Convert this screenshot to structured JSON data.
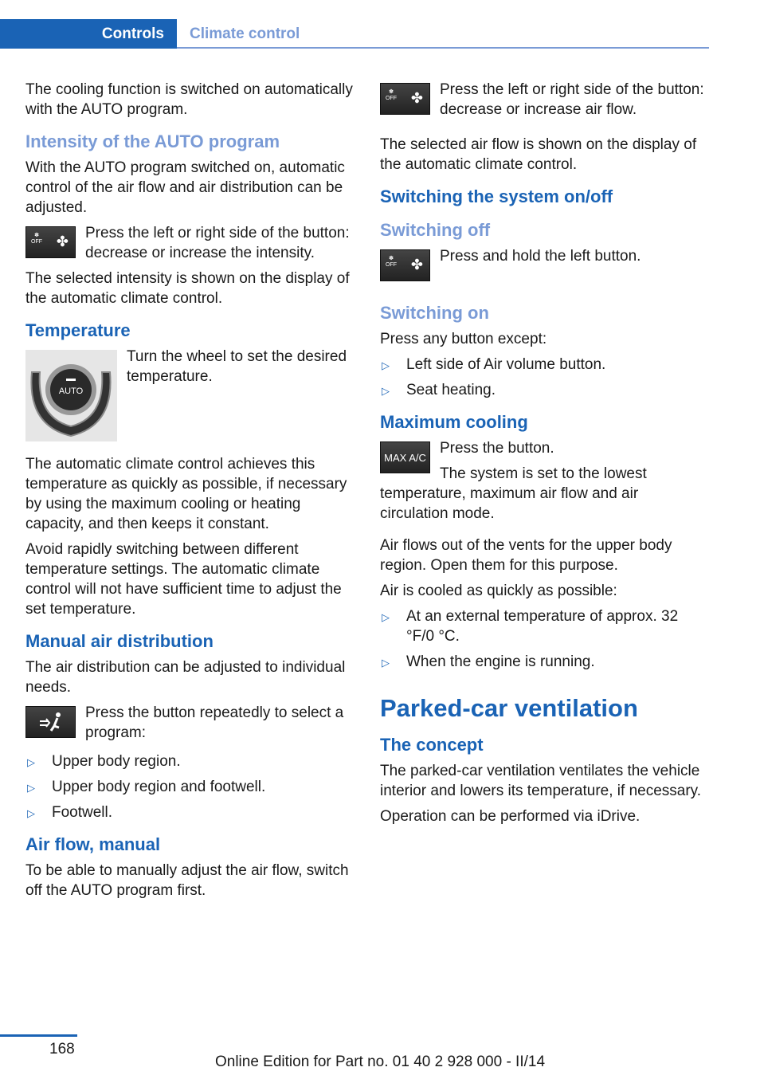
{
  "header": {
    "section": "Controls",
    "chapter": "Climate control"
  },
  "left": {
    "intro": "The cooling function is switched on automatically with the AUTO program.",
    "intensity": {
      "heading": "Intensity of the AUTO program",
      "p1": "With the AUTO program switched on, automatic control of the air flow and air distribution can be adjusted.",
      "p2": "Press the left or right side of the button: decrease or increase the intensity.",
      "p3": "The selected intensity is shown on the display of the automatic climate control."
    },
    "temperature": {
      "heading": "Temperature",
      "p1": "Turn the wheel to set the desired temperature.",
      "p2": "The automatic climate control achieves this temperature as quickly as possible, if necessary by using the maximum cooling or heating capacity, and then keeps it constant.",
      "p3": "Avoid rapidly switching between different temperature settings. The automatic climate control will not have sufficient time to adjust the set temperature."
    },
    "distribution": {
      "heading": "Manual air distribution",
      "p1": "The air distribution can be adjusted to individual needs.",
      "p2": "Press the button repeatedly to select a program:",
      "items": [
        "Upper body region.",
        "Upper body region and footwell.",
        "Footwell."
      ]
    },
    "airflow": {
      "heading": "Air flow, manual",
      "p1": "To be able to manually adjust the air flow, switch off the AUTO program first."
    }
  },
  "right": {
    "airflow_p2": "Press the left or right side of the button: decrease or increase air flow.",
    "airflow_p3": "The selected air flow is shown on the display of the automatic climate control.",
    "system_heading": "Switching the system on/off",
    "off_heading": "Switching off",
    "off_p": "Press and hold the left button.",
    "on_heading": "Switching on",
    "on_p": "Press any button except:",
    "on_items": [
      "Left side of Air volume button.",
      "Seat heating."
    ],
    "maxcool": {
      "heading": "Maximum cooling",
      "p1": "Press the button.",
      "p2": "The system is set to the lowest temperature, maximum air flow and air circulation mode.",
      "p3": "Air flows out of the vents for the upper body region. Open them for this purpose.",
      "p4": "Air is cooled as quickly as possible:",
      "items": [
        "At an external temperature of approx. 32 °F/0 °C.",
        "When the engine is running."
      ]
    },
    "parked": {
      "heading": "Parked-car ventilation",
      "concept_heading": "The concept",
      "p1": "The parked-car ventilation ventilates the vehicle interior and lowers its temperature, if necessary.",
      "p2": "Operation can be performed via iDrive."
    }
  },
  "buttons": {
    "off_label": "OFF",
    "auto_label": "AUTO",
    "maxac_label": "MAX A/C"
  },
  "footer": {
    "page": "168",
    "edition": "Online Edition for Part no. 01 40 2 928 000 - II/14"
  }
}
